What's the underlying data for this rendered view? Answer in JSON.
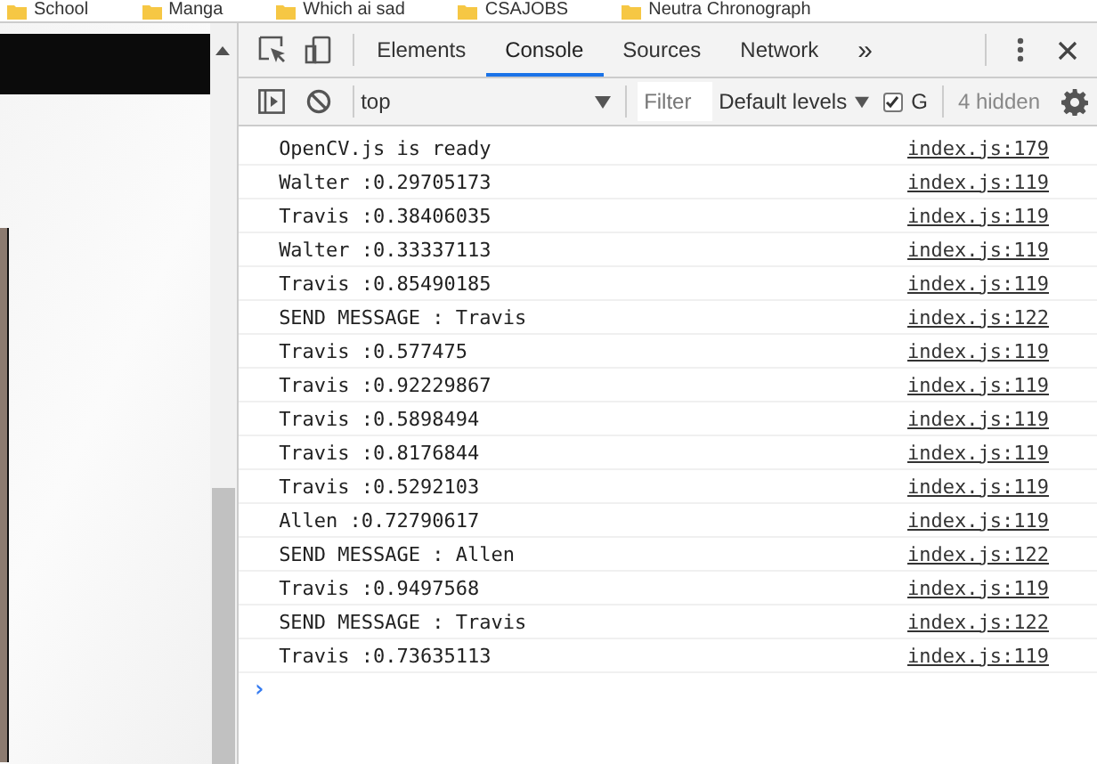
{
  "bookmarks": [
    {
      "label": "School"
    },
    {
      "label": "Manga"
    },
    {
      "label": "Which ai sad"
    },
    {
      "label": "CSAJOBS"
    },
    {
      "label": "Neutra Chronograph"
    }
  ],
  "devtools": {
    "tabs": [
      {
        "label": "Elements",
        "selected": false
      },
      {
        "label": "Console",
        "selected": true
      },
      {
        "label": "Sources",
        "selected": false
      },
      {
        "label": "Network",
        "selected": false
      }
    ],
    "more_tabs": "»",
    "context": "top",
    "filter_placeholder": "Filter",
    "levels": "Default levels",
    "group_checked": true,
    "group_label": "G",
    "hidden_count": "4 hidden"
  },
  "console": {
    "messages": [
      {
        "text": "OpenCV.js is ready",
        "source": "index.js:179"
      },
      {
        "text": "Walter :0.29705173",
        "source": "index.js:119"
      },
      {
        "text": "Travis :0.38406035",
        "source": "index.js:119"
      },
      {
        "text": "Walter :0.33337113",
        "source": "index.js:119"
      },
      {
        "text": "Travis :0.85490185",
        "source": "index.js:119"
      },
      {
        "text": "SEND MESSAGE : Travis",
        "source": "index.js:122"
      },
      {
        "text": "Travis :0.577475",
        "source": "index.js:119"
      },
      {
        "text": "Travis :0.92229867",
        "source": "index.js:119"
      },
      {
        "text": "Travis :0.5898494",
        "source": "index.js:119"
      },
      {
        "text": "Travis :0.8176844",
        "source": "index.js:119"
      },
      {
        "text": "Travis :0.5292103",
        "source": "index.js:119"
      },
      {
        "text": "Allen :0.72790617",
        "source": "index.js:119"
      },
      {
        "text": "SEND MESSAGE : Allen",
        "source": "index.js:122"
      },
      {
        "text": "Travis :0.9497568",
        "source": "index.js:119"
      },
      {
        "text": "SEND MESSAGE : Travis",
        "source": "index.js:122"
      },
      {
        "text": "Travis :0.73635113",
        "source": "index.js:119"
      }
    ],
    "prompt": "›"
  }
}
